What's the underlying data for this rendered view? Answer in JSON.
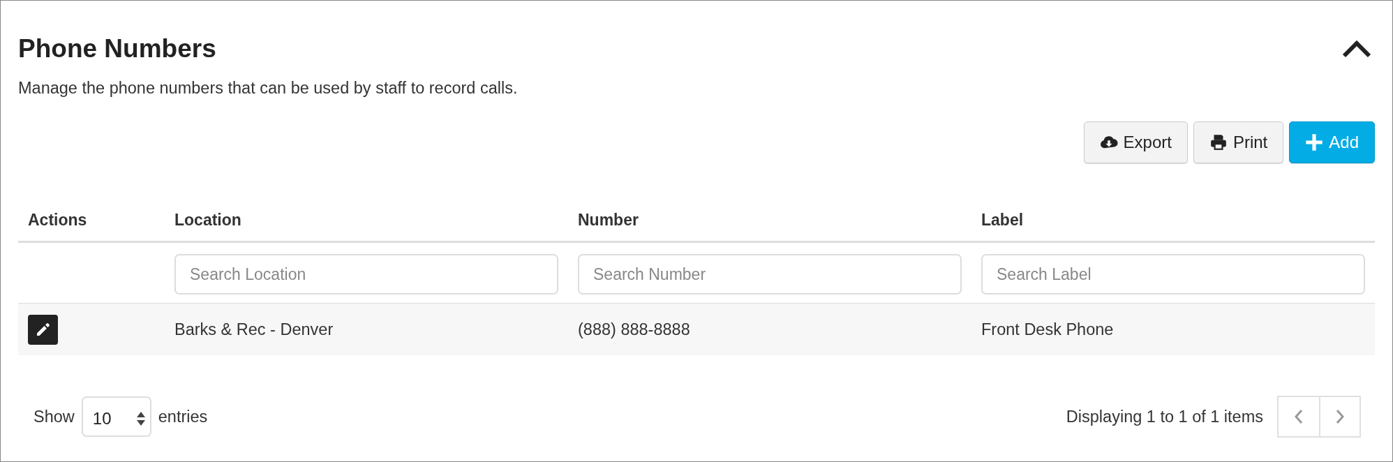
{
  "title": "Phone Numbers",
  "collapse": {
    "expanded": true
  },
  "description": "Manage the phone numbers that can be used by staff to record calls.",
  "buttons": [
    {
      "kind": "export",
      "label": "Export"
    },
    {
      "kind": "print",
      "label": "Print"
    },
    {
      "kind": "add",
      "label": "Add"
    }
  ],
  "table": {
    "columns": [
      "Actions",
      "Location",
      "Number",
      "Label"
    ],
    "filters": [
      {
        "placeholder": "Search Location"
      },
      {
        "placeholder": "Search Number"
      },
      {
        "placeholder": "Search Label"
      }
    ],
    "rows": [
      {
        "cells": [
          "",
          "Barks & Rec - Denver",
          "(888) 888-8888",
          "Front Desk Phone"
        ]
      }
    ]
  },
  "footer": {
    "show_label": "Show",
    "page_size": "10",
    "entries_label": "entries",
    "summary": "Displaying 1 to 1 of 1 items",
    "pager": [
      {
        "kind": "prev",
        "disabled": true
      },
      {
        "kind": "next",
        "disabled": true
      }
    ]
  }
}
